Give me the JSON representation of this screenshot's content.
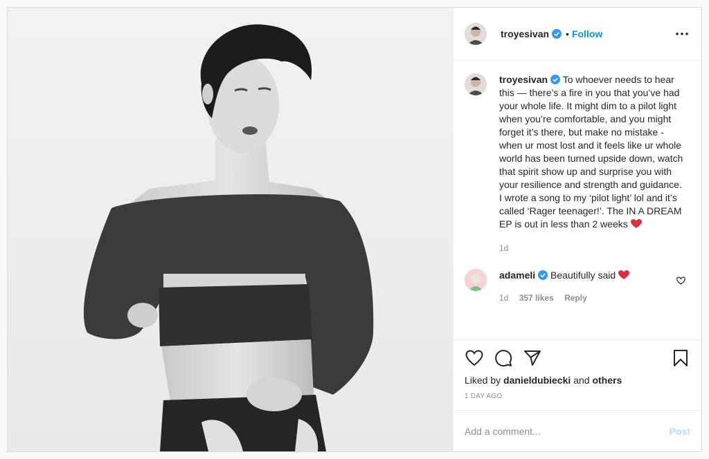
{
  "post": {
    "author": {
      "username": "troyesivan",
      "verified": true
    },
    "follow_label": "Follow",
    "separator": "•",
    "caption": "To whoever needs to hear this — there’s a fire in you that you’ve had your whole life. It might dim to a pilot light when you’re comfortable, and you might forget it’s there, but make no mistake - when ur most lost and it feels like ur whole world has been turned upside down, watch that spirit show up and surprise you with your resilience and strength and guidance. I wrote a song to my ‘pilot light’ lol and it’s called ‘Rager teenager!’. The IN A DREAM EP is out in less than 2 weeks",
    "caption_age": "1d",
    "comment": {
      "username": "adameli",
      "verified": true,
      "text": "Beautifully said",
      "age": "1d",
      "likes": "357 likes",
      "reply_label": "Reply"
    },
    "liked_by_prefix": "Liked by",
    "liked_by_user": "danieldubiecki",
    "liked_by_and": "and",
    "liked_by_others": "others",
    "time_ago": "1 DAY AGO",
    "add_comment_placeholder": "Add a comment...",
    "post_label": "Post"
  },
  "colors": {
    "accent": "#0095f6",
    "heart": "#ed4956",
    "muted": "#8e8e8e"
  },
  "icons": [
    "verified-badge-icon",
    "more-options-icon",
    "heart-icon",
    "comment-icon",
    "share-icon",
    "bookmark-icon",
    "red-heart-emoji-icon"
  ]
}
